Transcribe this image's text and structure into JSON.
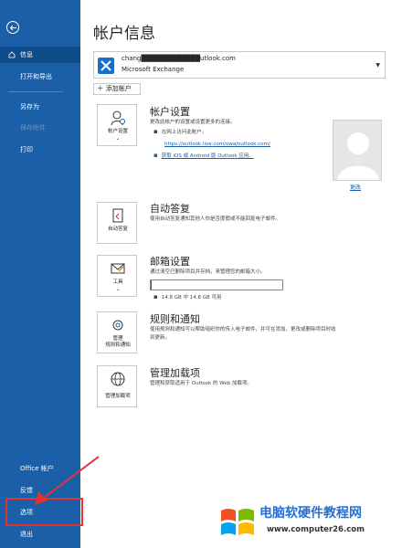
{
  "sidebar": {
    "items": [
      {
        "label": "信息"
      },
      {
        "label": "打开和导出"
      },
      {
        "label": "另存为"
      },
      {
        "label": "保存附件"
      },
      {
        "label": "打印"
      },
      {
        "label": "Office 帐户"
      },
      {
        "label": "反馈"
      },
      {
        "label": "选项"
      },
      {
        "label": "退出"
      }
    ]
  },
  "page": {
    "title": "帐户信息"
  },
  "account": {
    "email": "chang████████████utlook.com",
    "type": "Microsoft Exchange",
    "add_label": "添加帐户"
  },
  "sections": {
    "account_settings": {
      "tile_label": "帐户设置",
      "title": "帐户设置",
      "desc": "更改此帐户的设置或设置更多的连接。",
      "bullet1": "在网上访问此帐户。",
      "link1": "https://outlook.live.com/owa/outlook.com/",
      "link2": "获取 iOS 或 Android 版 Outlook 应用。",
      "change": "更改"
    },
    "auto_reply": {
      "tile_label": "自动答复",
      "title": "自动答复",
      "desc": "使用自动答复通知其他人你是否度假或不能回复电子邮件。"
    },
    "mailbox": {
      "tile_label": "工具",
      "title": "邮箱设置",
      "desc": "通过清空已删除项目并存档，来管理您的邮箱大小。",
      "usage": "14.8 GB 中 14.8 GB 可用",
      "used_fraction": 0.01
    },
    "rules": {
      "tile_label1": "管理",
      "tile_label2": "规则和通知",
      "title": "规则和通知",
      "desc1": "使用规则和通知可以帮助组织你的传入电子邮件，并可在添加、更改或删除项目时收",
      "desc2": "到更新。"
    },
    "addins": {
      "tile_label": "管理加载项",
      "title": "管理加载项",
      "desc": "管理和获取适用于 Outlook 的 Web 加载项。"
    }
  },
  "watermark": {
    "title": "电脑软硬件教程网",
    "url": "www.computer26.com"
  },
  "colors": {
    "sidebar": "#1a5fa8",
    "highlight": "#e5312f",
    "link": "#1a5fa8"
  }
}
